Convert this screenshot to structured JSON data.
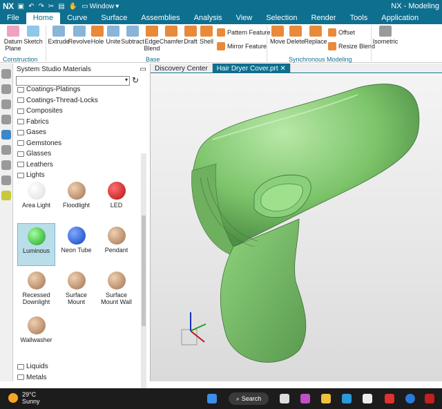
{
  "titlebar": {
    "logo": "NX",
    "window_menu": "Window",
    "app_title": "NX - Modeling"
  },
  "menu_tabs": [
    "File",
    "Home",
    "Curve",
    "Surface",
    "Assemblies",
    "Analysis",
    "View",
    "Selection",
    "Render",
    "Tools",
    "Application"
  ],
  "active_tab": "Home",
  "ribbon": {
    "construction": {
      "datum_plane": "Datum Plane",
      "sketch": "Sketch",
      "label": "Construction"
    },
    "base": {
      "extrude": "Extrude",
      "revolve": "Revolve",
      "hole": "Hole",
      "unite": "Unite",
      "subtract": "Subtract",
      "edge_blend": "Edge Blend",
      "chamfer": "Chamfer",
      "draft": "Draft",
      "shell": "Shell",
      "pattern_feature": "Pattern Feature",
      "mirror_feature": "Mirror Feature",
      "label": "Base"
    },
    "sync": {
      "move": "Move",
      "delete": "Delete",
      "replace": "Replace",
      "offset": "Offset",
      "resize_blend": "Resize Blend",
      "label": "Synchronous Modeling"
    },
    "isometric": "Isometric"
  },
  "panel": {
    "title": "System Studio Materials",
    "folders_top": [
      "Coatings-Platings",
      "Coatings-Thread-Locks",
      "Composites",
      "Fabrics",
      "Gases",
      "Gemstones",
      "Glasses",
      "Leathers",
      "Lights"
    ],
    "tiles": [
      {
        "label": "Area Light",
        "color": "#f0f0f0"
      },
      {
        "label": "Floodlight",
        "color": "#c8a27a"
      },
      {
        "label": "LED",
        "color": "#d02020"
      },
      {
        "label": "Luminous",
        "color": "#3fcf3f",
        "selected": true
      },
      {
        "label": "Neon Tube",
        "color": "#1f5ee8"
      },
      {
        "label": "Pendant",
        "color": "#c8a27a"
      },
      {
        "label": "Recessed Downlight",
        "color": "#c8a27a"
      },
      {
        "label": "Surface Mount",
        "color": "#c8a27a"
      },
      {
        "label": "Surface Mount Wall",
        "color": "#c8a27a"
      },
      {
        "label": "Wallwasher",
        "color": "#c8a27a"
      }
    ],
    "folders_bottom": [
      "Liquids",
      "Metals"
    ]
  },
  "doc_tabs": {
    "discovery": "Discovery Center",
    "part": "Hair Dryer Cover.prt"
  },
  "taskbar": {
    "temp": "29°C",
    "condition": "Sunny",
    "search": "Search"
  },
  "colors": {
    "accent": "#0e6f8f",
    "model_green": "#7cc46a"
  }
}
